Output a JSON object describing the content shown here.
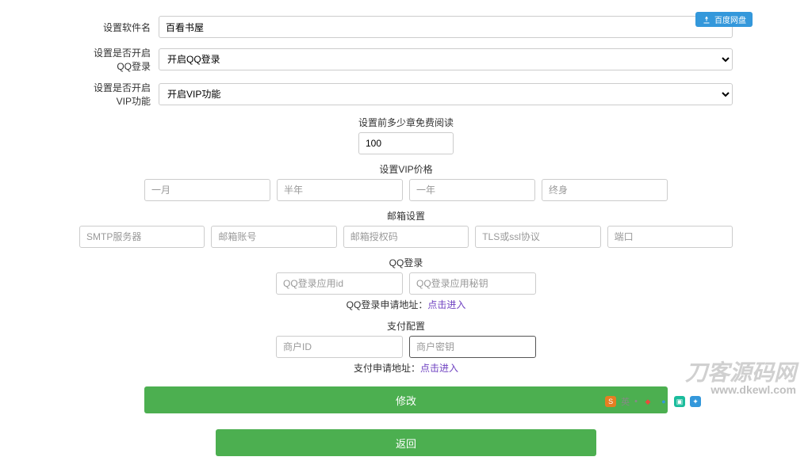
{
  "labels": {
    "software_name": "设置软件名",
    "qq_login_toggle": "设置是否开启QQ登录",
    "vip_toggle": "设置是否开启VIP功能"
  },
  "values": {
    "software_name": "百看书屋",
    "qq_login_option": "开启QQ登录",
    "vip_option": "开启VIP功能",
    "free_chapters": "100"
  },
  "sections": {
    "free_chapters": "设置前多少章免费阅读",
    "vip_price": "设置VIP价格",
    "mail_settings": "邮箱设置",
    "qq_login": "QQ登录",
    "pay_config": "支付配置"
  },
  "vip_placeholders": {
    "month": "一月",
    "half_year": "半年",
    "year": "一年",
    "lifetime": "终身"
  },
  "mail_placeholders": {
    "smtp": "SMTP服务器",
    "account": "邮箱账号",
    "auth": "邮箱授权码",
    "tls": "TLS或ssl协议",
    "port": "端口"
  },
  "qq_placeholders": {
    "app_id": "QQ登录应用id",
    "app_secret": "QQ登录应用秘钥"
  },
  "pay_placeholders": {
    "merchant_id": "商户ID",
    "merchant_secret": "商户密钥"
  },
  "links": {
    "qq_apply_prefix": "QQ登录申请地址：",
    "qq_apply_link": "点击进入",
    "pay_apply_prefix": "支付申请地址：",
    "pay_apply_link": "点击进入"
  },
  "buttons": {
    "modify": "修改",
    "back": "返回"
  },
  "badge": {
    "text": "百度网盘"
  },
  "watermark": {
    "title": "刀客源码网",
    "url": "www.dkewl.com"
  },
  "bottom_bar": {
    "lang": "英"
  }
}
